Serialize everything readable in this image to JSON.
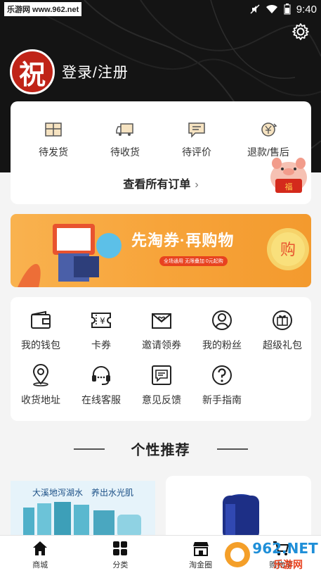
{
  "status_bar": {
    "watermark": "乐游网 www.962.net",
    "time": "9:40"
  },
  "user": {
    "avatar_glyph": "祝",
    "login_label": "登录/注册"
  },
  "orders": {
    "items": [
      {
        "label": "待发货",
        "icon": "package-icon"
      },
      {
        "label": "待收货",
        "icon": "truck-icon"
      },
      {
        "label": "待评价",
        "icon": "comment-icon"
      },
      {
        "label": "退款/售后",
        "icon": "refund-icon"
      }
    ],
    "view_all": "查看所有订单",
    "chevron": "›"
  },
  "banner": {
    "title": "先淘券·再购物",
    "subtitle": "全场通用 无限叠加 0元起购",
    "coin_text": "购"
  },
  "tools": {
    "items": [
      {
        "label": "我的钱包",
        "icon": "wallet-icon"
      },
      {
        "label": "卡券",
        "icon": "coupon-icon"
      },
      {
        "label": "邀请领券",
        "icon": "invite-icon"
      },
      {
        "label": "我的粉丝",
        "icon": "fans-icon"
      },
      {
        "label": "超级礼包",
        "icon": "gift-icon"
      },
      {
        "label": "收货地址",
        "icon": "location-icon"
      },
      {
        "label": "在线客服",
        "icon": "headset-icon"
      },
      {
        "label": "意见反馈",
        "icon": "feedback-icon"
      },
      {
        "label": "新手指南",
        "icon": "help-icon"
      }
    ]
  },
  "recommend": {
    "title": "个性推荐",
    "product1_caption": "大溪地泻湖水　养出水光肌"
  },
  "tabbar": {
    "items": [
      {
        "label": "商城",
        "icon": "home-icon"
      },
      {
        "label": "分类",
        "icon": "category-icon"
      },
      {
        "label": "淘金圈",
        "icon": "store-icon"
      },
      {
        "label": "购物车",
        "icon": "cart-icon"
      }
    ]
  },
  "corner_logo": {
    "text": "962.NET",
    "sub": "乐游网"
  },
  "colors": {
    "accent": "#f7a43a",
    "header_bg": "#141414",
    "avatar_red": "#c02418"
  }
}
